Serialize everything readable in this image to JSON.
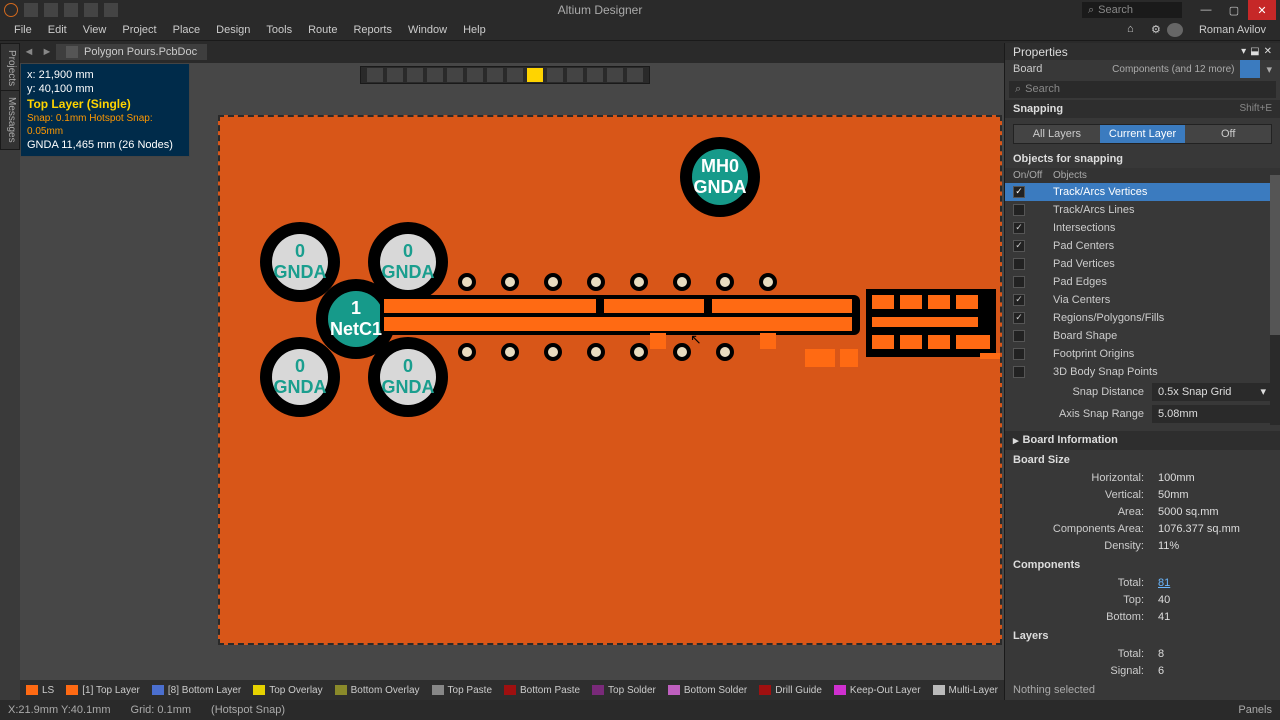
{
  "app": {
    "title": "Altium Designer",
    "search_placeholder": "Search",
    "user": "Roman Avilov"
  },
  "menu": [
    "File",
    "Edit",
    "View",
    "Project",
    "Place",
    "Design",
    "Tools",
    "Route",
    "Reports",
    "Window",
    "Help"
  ],
  "doc_tab": "Polygon Pours.PcbDoc",
  "info": {
    "x": "x: 21,900 mm",
    "y": "y: 40,100 mm",
    "layer": "Top Layer (Single)",
    "snap": "Snap: 0.1mm Hotspot Snap: 0.05mm",
    "net": "GNDA  11,465 mm  (26 Nodes)"
  },
  "pads": {
    "mh0": {
      "l1": "MH0",
      "l2": "GNDA"
    },
    "gnda0": {
      "l1": "0",
      "l2": "GNDA"
    },
    "net1": {
      "l1": "1",
      "l2": "NetC1"
    }
  },
  "properties": {
    "title": "Properties",
    "board_label": "Board",
    "scope": "Components (and 12 more)",
    "search_placeholder": "Search",
    "snapping": {
      "label": "Snapping",
      "hint": "Shift+E",
      "segs": [
        "All Layers",
        "Current Layer",
        "Off"
      ],
      "active": 1
    },
    "objects_label": "Objects for snapping",
    "obj_cols": [
      "On/Off",
      "Objects"
    ],
    "objects": [
      {
        "on": true,
        "name": "Track/Arcs Vertices",
        "sel": true
      },
      {
        "on": false,
        "name": "Track/Arcs Lines"
      },
      {
        "on": true,
        "name": "Intersections"
      },
      {
        "on": true,
        "name": "Pad Centers"
      },
      {
        "on": false,
        "name": "Pad Vertices"
      },
      {
        "on": false,
        "name": "Pad Edges"
      },
      {
        "on": true,
        "name": "Via Centers"
      },
      {
        "on": true,
        "name": "Regions/Polygons/Fills"
      },
      {
        "on": false,
        "name": "Board Shape"
      },
      {
        "on": false,
        "name": "Footprint Origins"
      },
      {
        "on": false,
        "name": "3D Body Snap Points"
      }
    ],
    "snap_distance": {
      "label": "Snap Distance",
      "value": "0.5x Snap Grid"
    },
    "axis_range": {
      "label": "Axis Snap Range",
      "value": "5.08mm"
    },
    "board_info": "Board Information",
    "board_size": {
      "label": "Board Size",
      "rows": [
        {
          "l": "Horizontal:",
          "v": "100mm"
        },
        {
          "l": "Vertical:",
          "v": "50mm"
        },
        {
          "l": "Area:",
          "v": "5000 sq.mm"
        },
        {
          "l": "Components Area:",
          "v": "1076.377 sq.mm"
        },
        {
          "l": "Density:",
          "v": "11%"
        }
      ]
    },
    "components": {
      "label": "Components",
      "rows": [
        {
          "l": "Total:",
          "v": "81",
          "link": true
        },
        {
          "l": "Top:",
          "v": "40"
        },
        {
          "l": "Bottom:",
          "v": "41"
        }
      ]
    },
    "layers": {
      "label": "Layers",
      "rows": [
        {
          "l": "Total:",
          "v": "8"
        },
        {
          "l": "Signal:",
          "v": "6"
        }
      ]
    },
    "nothing": "Nothing selected"
  },
  "layer_tabs": [
    {
      "c": "#ff6a13",
      "t": "LS"
    },
    {
      "c": "#ff6a13",
      "t": "[1] Top Layer"
    },
    {
      "c": "#4b6fcf",
      "t": "[8] Bottom Layer"
    },
    {
      "c": "#e6d200",
      "t": "Top Overlay"
    },
    {
      "c": "#8a8a2a",
      "t": "Bottom Overlay"
    },
    {
      "c": "#888888",
      "t": "Top Paste"
    },
    {
      "c": "#a01010",
      "t": "Bottom Paste"
    },
    {
      "c": "#7a2a7a",
      "t": "Top Solder"
    },
    {
      "c": "#c060c0",
      "t": "Bottom Solder"
    },
    {
      "c": "#a01010",
      "t": "Drill Guide"
    },
    {
      "c": "#d030d0",
      "t": "Keep-Out Layer"
    },
    {
      "c": "#bbbbbb",
      "t": "Multi-Layer"
    }
  ],
  "status": {
    "coord": "X:21.9mm Y:40.1mm",
    "grid": "Grid: 0.1mm",
    "snap": "(Hotspot Snap)",
    "panels": "Panels"
  }
}
